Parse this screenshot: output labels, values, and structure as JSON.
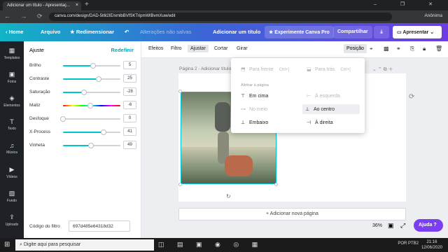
{
  "browser": {
    "tab_title": "Adicionar um título - Apresentaç...",
    "tab_close": "×",
    "new_tab": "+",
    "window_controls": "– ❐ ✕",
    "url": "canva.com/design/DAD-5t6l2IE/xmlbBVfSKTripmWlBvmXuw/edit",
    "user": "Anônima"
  },
  "topbar": {
    "home": "Home",
    "file": "Arquivo",
    "resize": "Redimensionar",
    "status": "Alterações não salvas",
    "title": "Adicionar um título",
    "try_pro": "Experimente Canva Pro",
    "share": "Compartilhar",
    "present": "Apresentar"
  },
  "rail": [
    {
      "icon": "▦",
      "label": "Templates"
    },
    {
      "icon": "▣",
      "label": "Fotos"
    },
    {
      "icon": "◈",
      "label": "Elementos"
    },
    {
      "icon": "T",
      "label": "Texto"
    },
    {
      "icon": "♫",
      "label": "Música"
    },
    {
      "icon": "▶",
      "label": "Vídeos"
    },
    {
      "icon": "▨",
      "label": "Fundo"
    },
    {
      "icon": "⇪",
      "label": "Uploads"
    }
  ],
  "panel": {
    "title": "Ajuste",
    "reset": "Redefinir",
    "sliders": [
      {
        "label": "Brilho",
        "value": 5,
        "min": -100,
        "max": 100
      },
      {
        "label": "Contraste",
        "value": 25,
        "min": -100,
        "max": 100
      },
      {
        "label": "Saturação",
        "value": -28,
        "min": -100,
        "max": 100
      },
      {
        "label": "Matiz",
        "value": -6,
        "min": -100,
        "max": 100
      },
      {
        "label": "Desfoque",
        "value": 0,
        "min": 0,
        "max": 100
      },
      {
        "label": "X-Process",
        "value": 41,
        "min": -100,
        "max": 100
      },
      {
        "label": "Vinheta",
        "value": 49,
        "min": 0,
        "max": 100
      }
    ],
    "filter_code_label": "Código do filtro",
    "filter_code": "697d485e64318d32"
  },
  "toolbar": {
    "effects": "Efeitos",
    "filter": "Filtro",
    "adjust": "Ajustar",
    "crop": "Cortar",
    "flip": "Girar",
    "position": "Posição"
  },
  "canvas": {
    "page_label": "Página 2 - Adicionar título",
    "add_page": "+ Adicionar nova página",
    "zoom": "36%",
    "help": "Ajuda ?"
  },
  "dropdown": {
    "forward": "Para frente",
    "forward_sc": "Ctrl+]",
    "backward": "Para trás",
    "backward_sc": "Ctrl+[",
    "section": "Alinhar à página",
    "top": "Em cima",
    "left": "À esquerda",
    "middle": "No meio",
    "center": "Ao centro",
    "bottom": "Embaixo",
    "right": "À direita"
  },
  "taskbar": {
    "search": "Digite aqui para pesquisar",
    "lang": "POR PTB2",
    "time": "21:16",
    "date": "12/06/2020"
  }
}
